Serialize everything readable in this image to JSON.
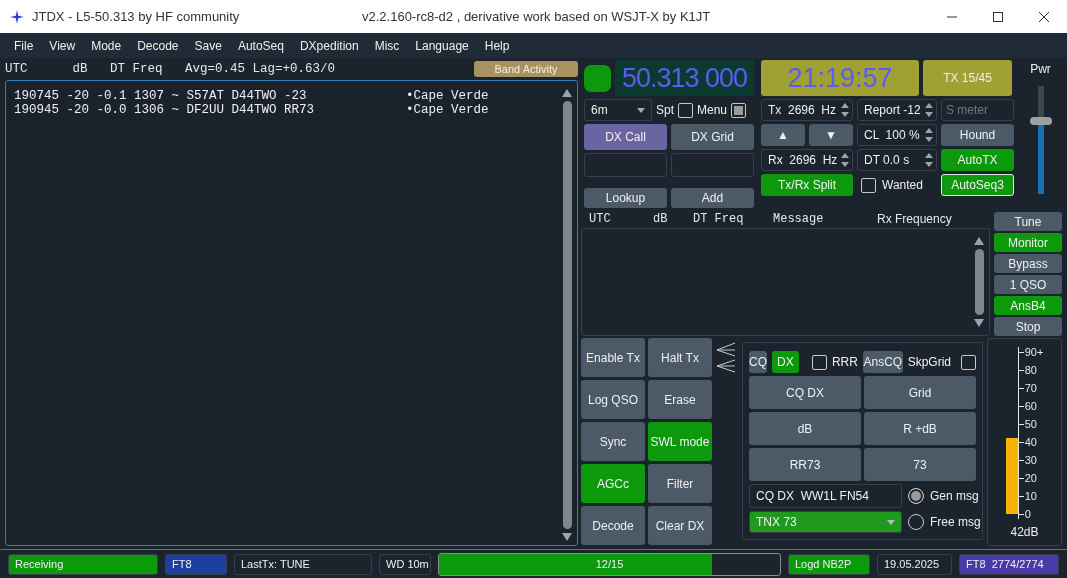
{
  "window": {
    "title": "JTDX - L5-50.313  by HF community",
    "subtitle": "v2.2.160-rc8-d2 , derivative work based on WSJT-X by K1JT"
  },
  "menu": [
    "File",
    "View",
    "Mode",
    "Decode",
    "Save",
    "AutoSeq",
    "DXpedition",
    "Misc",
    "Language",
    "Help"
  ],
  "band_activity": {
    "header": "UTC      dB   DT Freq   Avg=0.45 Lag=+0.63/0",
    "button": "Band Activity",
    "lines": [
      {
        "text": "190745 -20 -0.1 1307 ~ S57AT D44TWO -23",
        "country": "•Cape Verde"
      },
      {
        "text": "190945 -20 -0.0 1306 ~ DF2UU D44TWO RR73",
        "country": "•Cape Verde"
      }
    ]
  },
  "frequency": "50.313 000",
  "band": "6m",
  "spot": {
    "label": "Spt",
    "checked": false
  },
  "menu_toggle": {
    "label": "Menu",
    "checked": true
  },
  "dx_call": {
    "label": "DX Call",
    "selected": true
  },
  "dx_grid": {
    "label": "DX Grid",
    "selected": false
  },
  "lookup": "Lookup",
  "add": "Add",
  "clock": "21:19:57",
  "tx_period": "TX 15/45",
  "spin_fields": [
    {
      "value": "Tx  2696  Hz"
    },
    {
      "value": "Report -12"
    },
    {
      "value": "CL  100 %"
    },
    {
      "value": "Rx  2696  Hz"
    },
    {
      "value": "DT 0.0 s"
    }
  ],
  "s_meter": {
    "placeholder": "S meter"
  },
  "freq_buttons": [
    "▲",
    "▼"
  ],
  "hound": {
    "label": "Hound",
    "on": false
  },
  "autotx": {
    "label": "AutoTX",
    "on": true
  },
  "split": {
    "label": "Tx/Rx Split",
    "on": true
  },
  "wanted": {
    "label": "Wanted",
    "checked": false
  },
  "autoseq": {
    "label": "AutoSeq3",
    "on": true
  },
  "power": {
    "label": "Pwr",
    "level": 0.68
  },
  "rx_frequency": {
    "columns": [
      "UTC",
      "dB",
      "DT Freq",
      "Message",
      "Rx Frequency"
    ]
  },
  "side_buttons": [
    {
      "label": "Tune",
      "on": false
    },
    {
      "label": "Monitor",
      "on": true
    },
    {
      "label": "Bypass",
      "on": false
    },
    {
      "label": "1 QSO",
      "on": false
    },
    {
      "label": "AnsB4",
      "on": true
    },
    {
      "label": "Stop",
      "on": false
    }
  ],
  "control_buttons": [
    {
      "label": "Enable Tx",
      "on": false
    },
    {
      "label": "Halt Tx",
      "on": false
    },
    {
      "label": "Log QSO",
      "on": false
    },
    {
      "label": "Erase",
      "on": false
    },
    {
      "label": "Sync",
      "on": false
    },
    {
      "label": "SWL mode",
      "on": true
    },
    {
      "label": "AGCc",
      "on": true
    },
    {
      "label": "Filter",
      "on": false
    },
    {
      "label": "Decode",
      "on": false
    },
    {
      "label": "Clear DX",
      "on": false
    }
  ],
  "tx_panel": {
    "cq": {
      "label": "CQ",
      "on": false
    },
    "dx": {
      "label": "DX",
      "on": true
    },
    "rrr": {
      "label": "RRR",
      "checked": false
    },
    "anscq": {
      "label": "AnsCQ",
      "on": false
    },
    "skpgrid": {
      "label": "SkpGrid",
      "checked": false
    },
    "messages": [
      "CQ DX",
      "Grid",
      "dB",
      "R +dB",
      "RR73",
      "73"
    ],
    "gen_message": "CQ DX  WW1L FN54",
    "free_message": "TNX 73",
    "modes": [
      {
        "label": "Gen msg",
        "selected": true
      },
      {
        "label": "Free msg",
        "selected": false
      }
    ]
  },
  "signal_meter": {
    "ticks": [
      "90+",
      "80",
      "70",
      "60",
      "50",
      "40",
      "30",
      "20",
      "10",
      "0"
    ],
    "level": 0.47,
    "reading": "42dB"
  },
  "status_bar": [
    {
      "kind": "text",
      "text": "Receiving",
      "color": "#0a9a0a"
    },
    {
      "kind": "text",
      "text": "FT8",
      "color": "#1e3fa0"
    },
    {
      "kind": "text",
      "text": "LastTx: TUNE",
      "color": "#1b232c"
    },
    {
      "kind": "text",
      "text": "WD 10m",
      "color": "#1b232c"
    },
    {
      "kind": "progress",
      "text": "12/15",
      "level": 0.8
    },
    {
      "kind": "text",
      "text": "Logd NB2P",
      "color": "#0a9a0a"
    },
    {
      "kind": "text",
      "text": "19.05.2025",
      "color": "#1b232c"
    },
    {
      "kind": "text",
      "text": "FT8  2774/2774",
      "color": "#4a3aa8"
    }
  ]
}
